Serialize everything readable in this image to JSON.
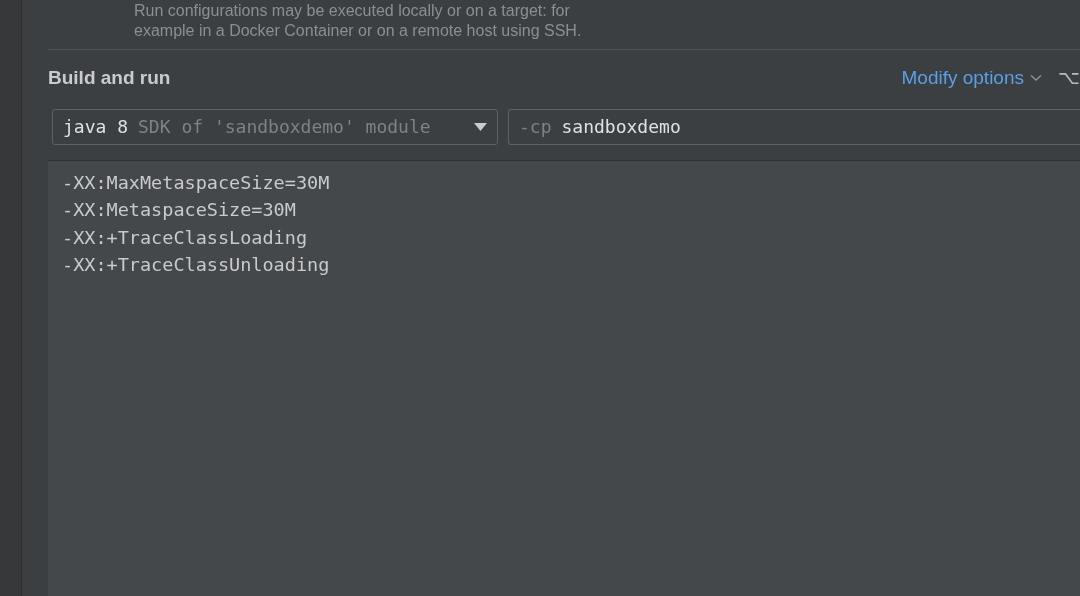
{
  "description": [
    "Run configurations may be executed locally or on a target: for",
    "example in a Docker Container or on a remote host using SSH."
  ],
  "section": {
    "title": "Build and run",
    "modify_options": "Modify options",
    "shortcut": "⌥"
  },
  "sdk": {
    "value": "java 8",
    "hint": "SDK of 'sandboxdemo' module"
  },
  "classpath": {
    "prefix": "-cp",
    "value": "sandboxdemo"
  },
  "vm_options": [
    "-XX:MaxMetaspaceSize=30M",
    "-XX:MetaspaceSize=30M",
    "-XX:+TraceClassLoading",
    "-XX:+TraceClassUnloading"
  ]
}
